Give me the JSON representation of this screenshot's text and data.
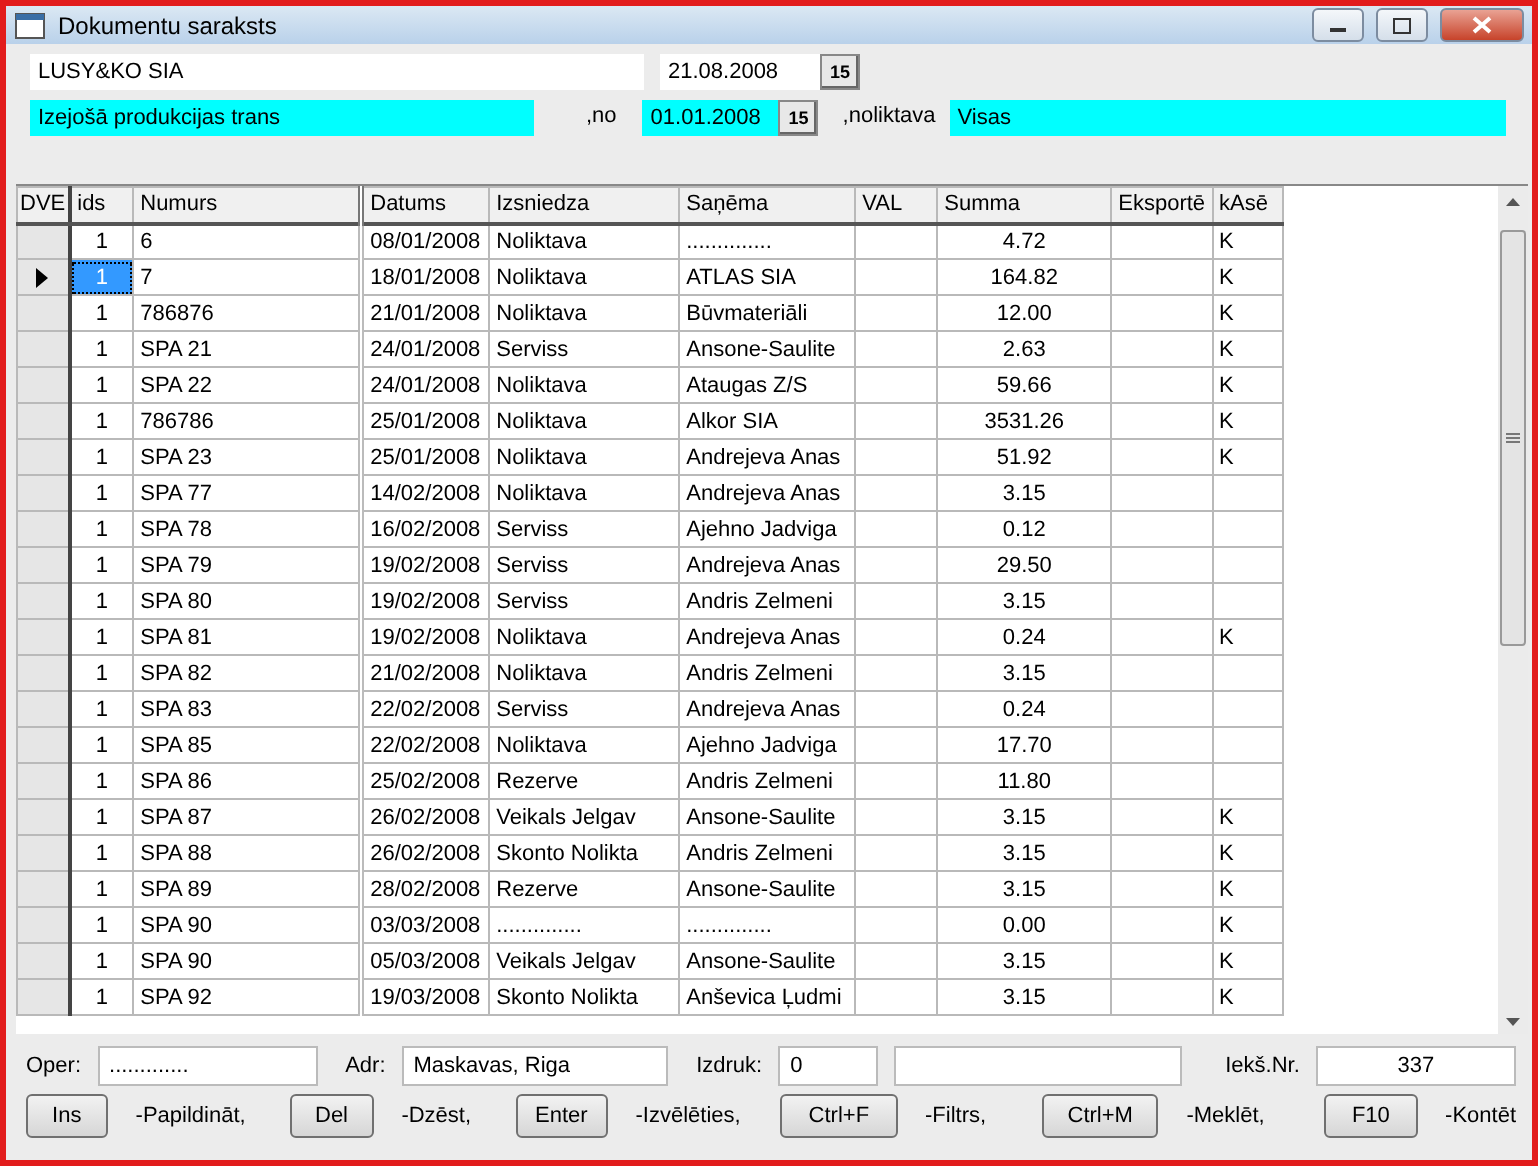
{
  "window": {
    "title": "Dokumentu saraksts"
  },
  "header": {
    "company": "LUSY&KO SIA",
    "date": "21.08.2008",
    "date_button": "15",
    "type": "Izejošā produkcijas trans",
    "from_label": ",no",
    "from_date": "01.01.2008",
    "from_button": "15",
    "store_label": ",noliktava",
    "store": "Visas"
  },
  "table": {
    "corner": "DVE",
    "columns": [
      "ids",
      "Numurs",
      "Datums",
      "Izsniedza",
      "Saņēma",
      "VAL",
      "Summa",
      "Eksportē",
      "kAsē"
    ],
    "rows": [
      {
        "selected": false,
        "cells": [
          "1",
          "6",
          "08/01/2008",
          "Noliktava",
          "..............",
          "",
          "4.72",
          "",
          "K"
        ]
      },
      {
        "selected": true,
        "cells": [
          "1",
          "7",
          "18/01/2008",
          "Noliktava",
          "ATLAS SIA",
          "",
          "164.82",
          "",
          "K"
        ]
      },
      {
        "selected": false,
        "cells": [
          "1",
          "786876",
          "21/01/2008",
          "Noliktava",
          "Būvmateriāli",
          "",
          "12.00",
          "",
          "K"
        ]
      },
      {
        "selected": false,
        "cells": [
          "1",
          "SPA 21",
          "24/01/2008",
          "Serviss",
          "Ansone-Saulite",
          "",
          "2.63",
          "",
          "K"
        ]
      },
      {
        "selected": false,
        "cells": [
          "1",
          "SPA 22",
          "24/01/2008",
          "Noliktava",
          "Ataugas Z/S",
          "",
          "59.66",
          "",
          "K"
        ]
      },
      {
        "selected": false,
        "cells": [
          "1",
          "786786",
          "25/01/2008",
          "Noliktava",
          "Alkor SIA",
          "",
          "3531.26",
          "",
          "K"
        ]
      },
      {
        "selected": false,
        "cells": [
          "1",
          "SPA 23",
          "25/01/2008",
          "Noliktava",
          "Andrejeva Anas",
          "",
          "51.92",
          "",
          "K"
        ]
      },
      {
        "selected": false,
        "cells": [
          "1",
          "SPA 77",
          "14/02/2008",
          "Noliktava",
          "Andrejeva Anas",
          "",
          "3.15",
          "",
          ""
        ]
      },
      {
        "selected": false,
        "cells": [
          "1",
          "SPA 78",
          "16/02/2008",
          "Serviss",
          "Ajehno Jadviga",
          "",
          "0.12",
          "",
          ""
        ]
      },
      {
        "selected": false,
        "cells": [
          "1",
          "SPA 79",
          "19/02/2008",
          "Serviss",
          "Andrejeva Anas",
          "",
          "29.50",
          "",
          ""
        ]
      },
      {
        "selected": false,
        "cells": [
          "1",
          "SPA 80",
          "19/02/2008",
          "Serviss",
          "Andris Zelmeni",
          "",
          "3.15",
          "",
          ""
        ]
      },
      {
        "selected": false,
        "cells": [
          "1",
          "SPA 81",
          "19/02/2008",
          "Noliktava",
          "Andrejeva Anas",
          "",
          "0.24",
          "",
          "K"
        ]
      },
      {
        "selected": false,
        "cells": [
          "1",
          "SPA 82",
          "21/02/2008",
          "Noliktava",
          "Andris Zelmeni",
          "",
          "3.15",
          "",
          ""
        ]
      },
      {
        "selected": false,
        "cells": [
          "1",
          "SPA 83",
          "22/02/2008",
          "Serviss",
          "Andrejeva Anas",
          "",
          "0.24",
          "",
          ""
        ]
      },
      {
        "selected": false,
        "cells": [
          "1",
          "SPA 85",
          "22/02/2008",
          "Noliktava",
          "Ajehno Jadviga",
          "",
          "17.70",
          "",
          ""
        ]
      },
      {
        "selected": false,
        "cells": [
          "1",
          "SPA 86",
          "25/02/2008",
          "Rezerve",
          "Andris Zelmeni",
          "",
          "11.80",
          "",
          ""
        ]
      },
      {
        "selected": false,
        "cells": [
          "1",
          "SPA 87",
          "26/02/2008",
          "Veikals Jelgav",
          "Ansone-Saulite",
          "",
          "3.15",
          "",
          "K"
        ]
      },
      {
        "selected": false,
        "cells": [
          "1",
          "SPA 88",
          "26/02/2008",
          "Skonto Nolikta",
          "Andris Zelmeni",
          "",
          "3.15",
          "",
          "K"
        ]
      },
      {
        "selected": false,
        "cells": [
          "1",
          "SPA 89",
          "28/02/2008",
          "Rezerve",
          "Ansone-Saulite",
          "",
          "3.15",
          "",
          "K"
        ]
      },
      {
        "selected": false,
        "cells": [
          "1",
          "SPA 90",
          "03/03/2008",
          "..............",
          "..............",
          "",
          "0.00",
          "",
          "K"
        ]
      },
      {
        "selected": false,
        "cells": [
          "1",
          "SPA 90",
          "05/03/2008",
          "Veikals Jelgav",
          "Ansone-Saulite",
          "",
          "3.15",
          "",
          "K"
        ]
      },
      {
        "selected": false,
        "cells": [
          "1",
          "SPA 92",
          "19/03/2008",
          "Skonto Nolikta",
          "Anševica Ļudmi",
          "",
          "3.15",
          "",
          "K"
        ]
      }
    ]
  },
  "footer_fields": [
    {
      "kind": "labeled",
      "label": "Oper:",
      "value": "............."
    },
    {
      "kind": "labeled",
      "label": "Adr:",
      "value": "Maskavas, Riga"
    },
    {
      "kind": "labeled",
      "label": "Izdruk:",
      "value": "0"
    },
    {
      "kind": "blank"
    },
    {
      "kind": "labeled",
      "label": "Iekš.Nr.",
      "value": "337"
    }
  ],
  "keys": [
    {
      "key": "Ins",
      "label": "-Papildināt,"
    },
    {
      "key": "Del",
      "label": "-Dzēst,"
    },
    {
      "key": "Enter",
      "label": "-Izvēlēties,"
    },
    {
      "key": "Ctrl+F",
      "label": "-Filtrs,"
    },
    {
      "key": "Ctrl+M",
      "label": "-Meklēt,"
    },
    {
      "key": "F10",
      "label": "-Kontēt"
    }
  ]
}
